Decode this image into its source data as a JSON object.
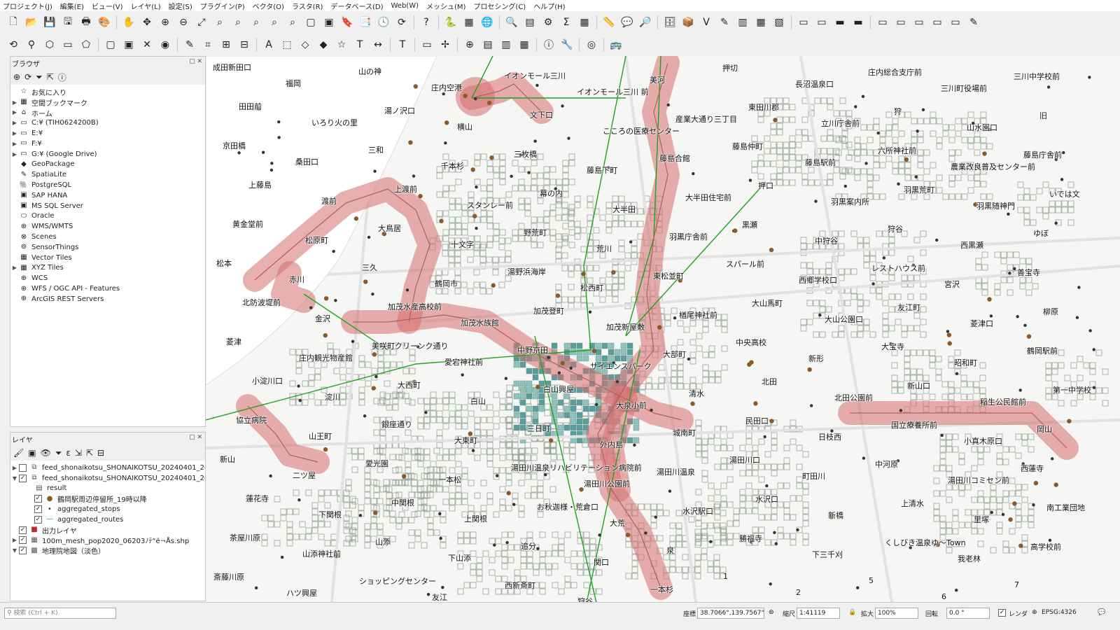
{
  "menu": [
    "プロジェクト(J)",
    "編集(E)",
    "ビュー(V)",
    "レイヤ(L)",
    "設定(S)",
    "プラグイン(P)",
    "ベクタ(O)",
    "ラスタ(R)",
    "データベース(D)",
    "Web(W)",
    "メッシュ(M)",
    "プロセシング(C)",
    "ヘルプ(H)"
  ],
  "browser": {
    "title": "ブラウザ",
    "items": [
      {
        "label": "お気に入り",
        "icon": "star-icon",
        "expand": false
      },
      {
        "label": "空間ブックマーク",
        "icon": "bookmark-icon",
        "expand": true
      },
      {
        "label": "ホーム",
        "icon": "home-folder-icon",
        "expand": true
      },
      {
        "label": "C:¥ (TIH0624200B)",
        "icon": "drive-icon",
        "expand": true
      },
      {
        "label": "E:¥",
        "icon": "drive-icon",
        "expand": true
      },
      {
        "label": "F:¥",
        "icon": "drive-icon",
        "expand": true
      },
      {
        "label": "G:¥ (Google Drive)",
        "icon": "drive-icon",
        "expand": true
      },
      {
        "label": "GeoPackage",
        "icon": "geopackage-icon",
        "expand": false
      },
      {
        "label": "SpatiaLite",
        "icon": "spatialite-icon",
        "expand": false
      },
      {
        "label": "PostgreSQL",
        "icon": "postgresql-icon",
        "expand": false
      },
      {
        "label": "SAP HANA",
        "icon": "sap-hana-icon",
        "expand": false
      },
      {
        "label": "MS SQL Server",
        "icon": "mssql-icon",
        "expand": false
      },
      {
        "label": "Oracle",
        "icon": "oracle-icon",
        "expand": false
      },
      {
        "label": "WMS/WMTS",
        "icon": "wms-icon",
        "expand": false
      },
      {
        "label": "Scenes",
        "icon": "scenes-icon",
        "expand": false
      },
      {
        "label": "SensorThings",
        "icon": "sensorthings-icon",
        "expand": false
      },
      {
        "label": "Vector Tiles",
        "icon": "vector-tiles-icon",
        "expand": false
      },
      {
        "label": "XYZ Tiles",
        "icon": "xyz-tiles-icon",
        "expand": true
      },
      {
        "label": "WCS",
        "icon": "wcs-icon",
        "expand": false
      },
      {
        "label": "WFS / OGC API - Features",
        "icon": "wfs-icon",
        "expand": false
      },
      {
        "label": "ArcGIS REST Servers",
        "icon": "arcgis-icon",
        "expand": false
      }
    ]
  },
  "layers": {
    "title": "レイヤ",
    "items": [
      {
        "label": "feed_shonaikotsu_SHONAIKOTSU_20240401_202405",
        "checked": false,
        "expand": "right",
        "indent": 0,
        "sym": "group-icon"
      },
      {
        "label": "feed_shonaikotsu_SHONAIKOTSU_20240401_202405",
        "checked": true,
        "expand": "down",
        "indent": 0,
        "sym": "group-icon"
      },
      {
        "label": "result",
        "checked": null,
        "expand": "",
        "indent": 1,
        "sym": "table-icon"
      },
      {
        "label": "鶴岡駅周辺停留所_19時以降",
        "checked": true,
        "expand": "",
        "indent": 1,
        "sym": "brown-point-icon"
      },
      {
        "label": "aggregated_stops",
        "checked": true,
        "expand": "",
        "indent": 1,
        "sym": "point-icon"
      },
      {
        "label": "aggregated_routes",
        "checked": true,
        "expand": "",
        "indent": 1,
        "sym": "green-line-icon"
      },
      {
        "label": "出力レイヤ",
        "checked": true,
        "expand": "",
        "indent": 0,
        "sym": "red-polygon-icon"
      },
      {
        "label": "100m_mesh_pop2020_06203ﾉﾃ“ë¬Ås.shp",
        "checked": true,
        "expand": "right",
        "indent": 0,
        "sym": "raster-icon"
      },
      {
        "label": "地理院地図（淡色）",
        "checked": true,
        "expand": "down",
        "indent": 0,
        "sym": "xyz-icon"
      }
    ]
  },
  "search": {
    "placeholder": "検索 (Ctrl + K)"
  },
  "status": {
    "coord_label": "座標",
    "coord": "38.7066°,139.7567°",
    "scale_label": "縮尺",
    "scale": "1:41119",
    "magnifier_label": "拡大",
    "magnifier": "100%",
    "rotation_label": "回転",
    "rotation": "0.0 °",
    "render_label": "レンダ",
    "crs": "EPSG:4326"
  },
  "map_labels": [
    "成田新田口",
    "福岡",
    "山の神",
    "庄内空港",
    "イオンモール三川",
    "イオンモール三川 前",
    "美河",
    "押切",
    "長沼温泉口",
    "庄内総合支庁前",
    "三川町役場前",
    "三川中学校前",
    "田田前",
    "いろり火の里",
    "湯ノ沢口",
    "横山",
    "文下口",
    "こころの医療センター",
    "産業大通り三丁目",
    "東田川郡",
    "立川庁舎前",
    "狩",
    "山水園口",
    "旧",
    "京田橋",
    "桑田口",
    "三和",
    "千本杉",
    "三枚橋",
    "藤島下町",
    "藤島合館",
    "藤島仲町",
    "藤島駅前",
    "六所神社前",
    "農業改良普及センター前",
    "藤島庁舎前",
    "上藤島",
    "渡前",
    "上渡前",
    "スタンレー前",
    "幕の内",
    "大半田",
    "大半田住宅前",
    "押口",
    "羽黒案内所",
    "羽黒荒町",
    "羽黒随神門",
    "いでは文",
    "黄金堂前",
    "松原町",
    "大鳥居",
    "十文字",
    "野荒町",
    "荒川",
    "羽黒庁舎前",
    "黒瀬",
    "中狩谷",
    "狩谷",
    "西黒瀬",
    "ゆぼ",
    "松本",
    "赤川",
    "三久",
    "鶴岡市",
    "湯野浜海岸",
    "松西町",
    "東松並町",
    "スパール前",
    "西郷学校口",
    "レストハウス前",
    "宮沢",
    "善宝寺",
    "北防波堤前",
    "金沢",
    "加茂水産高校前",
    "加茂水族館",
    "加茂登町",
    "加茂新屋敷",
    "楢尾神社前",
    "大山馬町",
    "大山公園口",
    "友江町",
    "菱津口",
    "柳原",
    "菱津",
    "庄内観光物産館",
    "美咲町クリーンク通り",
    "愛宕神社前",
    "中野京田",
    "サイエンスパーク",
    "大部町",
    "中央高校",
    "新形",
    "大宝寺",
    "昭和町",
    "鶴岡駅前",
    "小淀川口",
    "淀川",
    "大西町",
    "白山",
    "白山興屋",
    "大泉小前",
    "清水",
    "北田",
    "北田公園前",
    "新山口",
    "稲生公民館前",
    "第一中学校",
    "協立病院",
    "山王町",
    "銀座通り",
    "大東町",
    "三日町",
    "外内島",
    "城南町",
    "民田口",
    "日枝西",
    "国立療養所前",
    "小真木原口",
    "岡山",
    "新山",
    "二ツ屋",
    "愛光園",
    "一本松",
    "湯田川温泉リハビリテーション病院前",
    "湯田川公園前",
    "湯田川温泉",
    "湯田川口",
    "町田川",
    "中河原",
    "湯田川コミセン前",
    "西蓮寺",
    "蓮花寺",
    "下関根",
    "中関根",
    "上関根",
    "お秋迦様・荒倉口",
    "大荒",
    "水沢駅口",
    "水沢口",
    "新橋",
    "上清水",
    "里塚",
    "南工業団地",
    "茶屋川原",
    "山添神社前",
    "山添",
    "下山添",
    "追分",
    "関口",
    "泉",
    "勝福寺",
    "下三千刈",
    "くしびき温泉ゆ～Town",
    "我老林",
    "高学校前",
    "斎藤川原",
    "ハツ興屋",
    "ショッピングセンター",
    "友江",
    "西新斎町",
    "狩谷",
    "一本杉",
    "1",
    "2",
    "5",
    "6",
    "7"
  ]
}
